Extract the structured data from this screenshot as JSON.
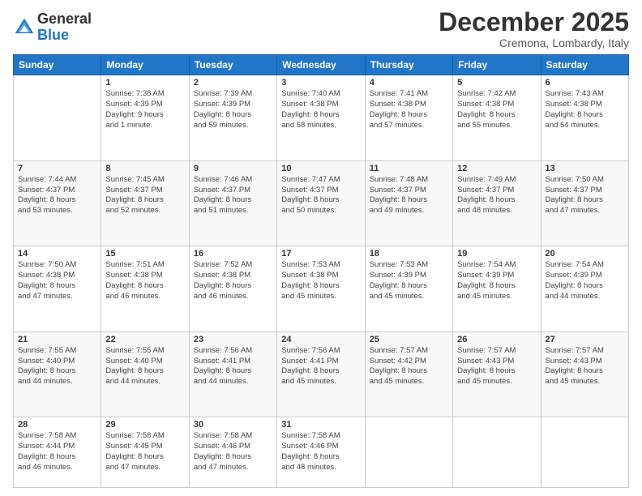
{
  "logo": {
    "general": "General",
    "blue": "Blue"
  },
  "title": "December 2025",
  "location": "Cremona, Lombardy, Italy",
  "weekdays": [
    "Sunday",
    "Monday",
    "Tuesday",
    "Wednesday",
    "Thursday",
    "Friday",
    "Saturday"
  ],
  "weeks": [
    [
      {
        "day": "",
        "info": ""
      },
      {
        "day": "1",
        "info": "Sunrise: 7:38 AM\nSunset: 4:39 PM\nDaylight: 9 hours\nand 1 minute."
      },
      {
        "day": "2",
        "info": "Sunrise: 7:39 AM\nSunset: 4:39 PM\nDaylight: 8 hours\nand 59 minutes."
      },
      {
        "day": "3",
        "info": "Sunrise: 7:40 AM\nSunset: 4:38 PM\nDaylight: 8 hours\nand 58 minutes."
      },
      {
        "day": "4",
        "info": "Sunrise: 7:41 AM\nSunset: 4:38 PM\nDaylight: 8 hours\nand 57 minutes."
      },
      {
        "day": "5",
        "info": "Sunrise: 7:42 AM\nSunset: 4:38 PM\nDaylight: 8 hours\nand 55 minutes."
      },
      {
        "day": "6",
        "info": "Sunrise: 7:43 AM\nSunset: 4:38 PM\nDaylight: 8 hours\nand 54 minutes."
      }
    ],
    [
      {
        "day": "7",
        "info": "Sunrise: 7:44 AM\nSunset: 4:37 PM\nDaylight: 8 hours\nand 53 minutes."
      },
      {
        "day": "8",
        "info": "Sunrise: 7:45 AM\nSunset: 4:37 PM\nDaylight: 8 hours\nand 52 minutes."
      },
      {
        "day": "9",
        "info": "Sunrise: 7:46 AM\nSunset: 4:37 PM\nDaylight: 8 hours\nand 51 minutes."
      },
      {
        "day": "10",
        "info": "Sunrise: 7:47 AM\nSunset: 4:37 PM\nDaylight: 8 hours\nand 50 minutes."
      },
      {
        "day": "11",
        "info": "Sunrise: 7:48 AM\nSunset: 4:37 PM\nDaylight: 8 hours\nand 49 minutes."
      },
      {
        "day": "12",
        "info": "Sunrise: 7:49 AM\nSunset: 4:37 PM\nDaylight: 8 hours\nand 48 minutes."
      },
      {
        "day": "13",
        "info": "Sunrise: 7:50 AM\nSunset: 4:37 PM\nDaylight: 8 hours\nand 47 minutes."
      }
    ],
    [
      {
        "day": "14",
        "info": "Sunrise: 7:50 AM\nSunset: 4:38 PM\nDaylight: 8 hours\nand 47 minutes."
      },
      {
        "day": "15",
        "info": "Sunrise: 7:51 AM\nSunset: 4:38 PM\nDaylight: 8 hours\nand 46 minutes."
      },
      {
        "day": "16",
        "info": "Sunrise: 7:52 AM\nSunset: 4:38 PM\nDaylight: 8 hours\nand 46 minutes."
      },
      {
        "day": "17",
        "info": "Sunrise: 7:53 AM\nSunset: 4:38 PM\nDaylight: 8 hours\nand 45 minutes."
      },
      {
        "day": "18",
        "info": "Sunrise: 7:53 AM\nSunset: 4:39 PM\nDaylight: 8 hours\nand 45 minutes."
      },
      {
        "day": "19",
        "info": "Sunrise: 7:54 AM\nSunset: 4:39 PM\nDaylight: 8 hours\nand 45 minutes."
      },
      {
        "day": "20",
        "info": "Sunrise: 7:54 AM\nSunset: 4:39 PM\nDaylight: 8 hours\nand 44 minutes."
      }
    ],
    [
      {
        "day": "21",
        "info": "Sunrise: 7:55 AM\nSunset: 4:40 PM\nDaylight: 8 hours\nand 44 minutes."
      },
      {
        "day": "22",
        "info": "Sunrise: 7:55 AM\nSunset: 4:40 PM\nDaylight: 8 hours\nand 44 minutes."
      },
      {
        "day": "23",
        "info": "Sunrise: 7:56 AM\nSunset: 4:41 PM\nDaylight: 8 hours\nand 44 minutes."
      },
      {
        "day": "24",
        "info": "Sunrise: 7:56 AM\nSunset: 4:41 PM\nDaylight: 8 hours\nand 45 minutes."
      },
      {
        "day": "25",
        "info": "Sunrise: 7:57 AM\nSunset: 4:42 PM\nDaylight: 8 hours\nand 45 minutes."
      },
      {
        "day": "26",
        "info": "Sunrise: 7:57 AM\nSunset: 4:43 PM\nDaylight: 8 hours\nand 45 minutes."
      },
      {
        "day": "27",
        "info": "Sunrise: 7:57 AM\nSunset: 4:43 PM\nDaylight: 8 hours\nand 45 minutes."
      }
    ],
    [
      {
        "day": "28",
        "info": "Sunrise: 7:58 AM\nSunset: 4:44 PM\nDaylight: 8 hours\nand 46 minutes."
      },
      {
        "day": "29",
        "info": "Sunrise: 7:58 AM\nSunset: 4:45 PM\nDaylight: 8 hours\nand 47 minutes."
      },
      {
        "day": "30",
        "info": "Sunrise: 7:58 AM\nSunset: 4:46 PM\nDaylight: 8 hours\nand 47 minutes."
      },
      {
        "day": "31",
        "info": "Sunrise: 7:58 AM\nSunset: 4:46 PM\nDaylight: 8 hours\nand 48 minutes."
      },
      {
        "day": "",
        "info": ""
      },
      {
        "day": "",
        "info": ""
      },
      {
        "day": "",
        "info": ""
      }
    ]
  ]
}
